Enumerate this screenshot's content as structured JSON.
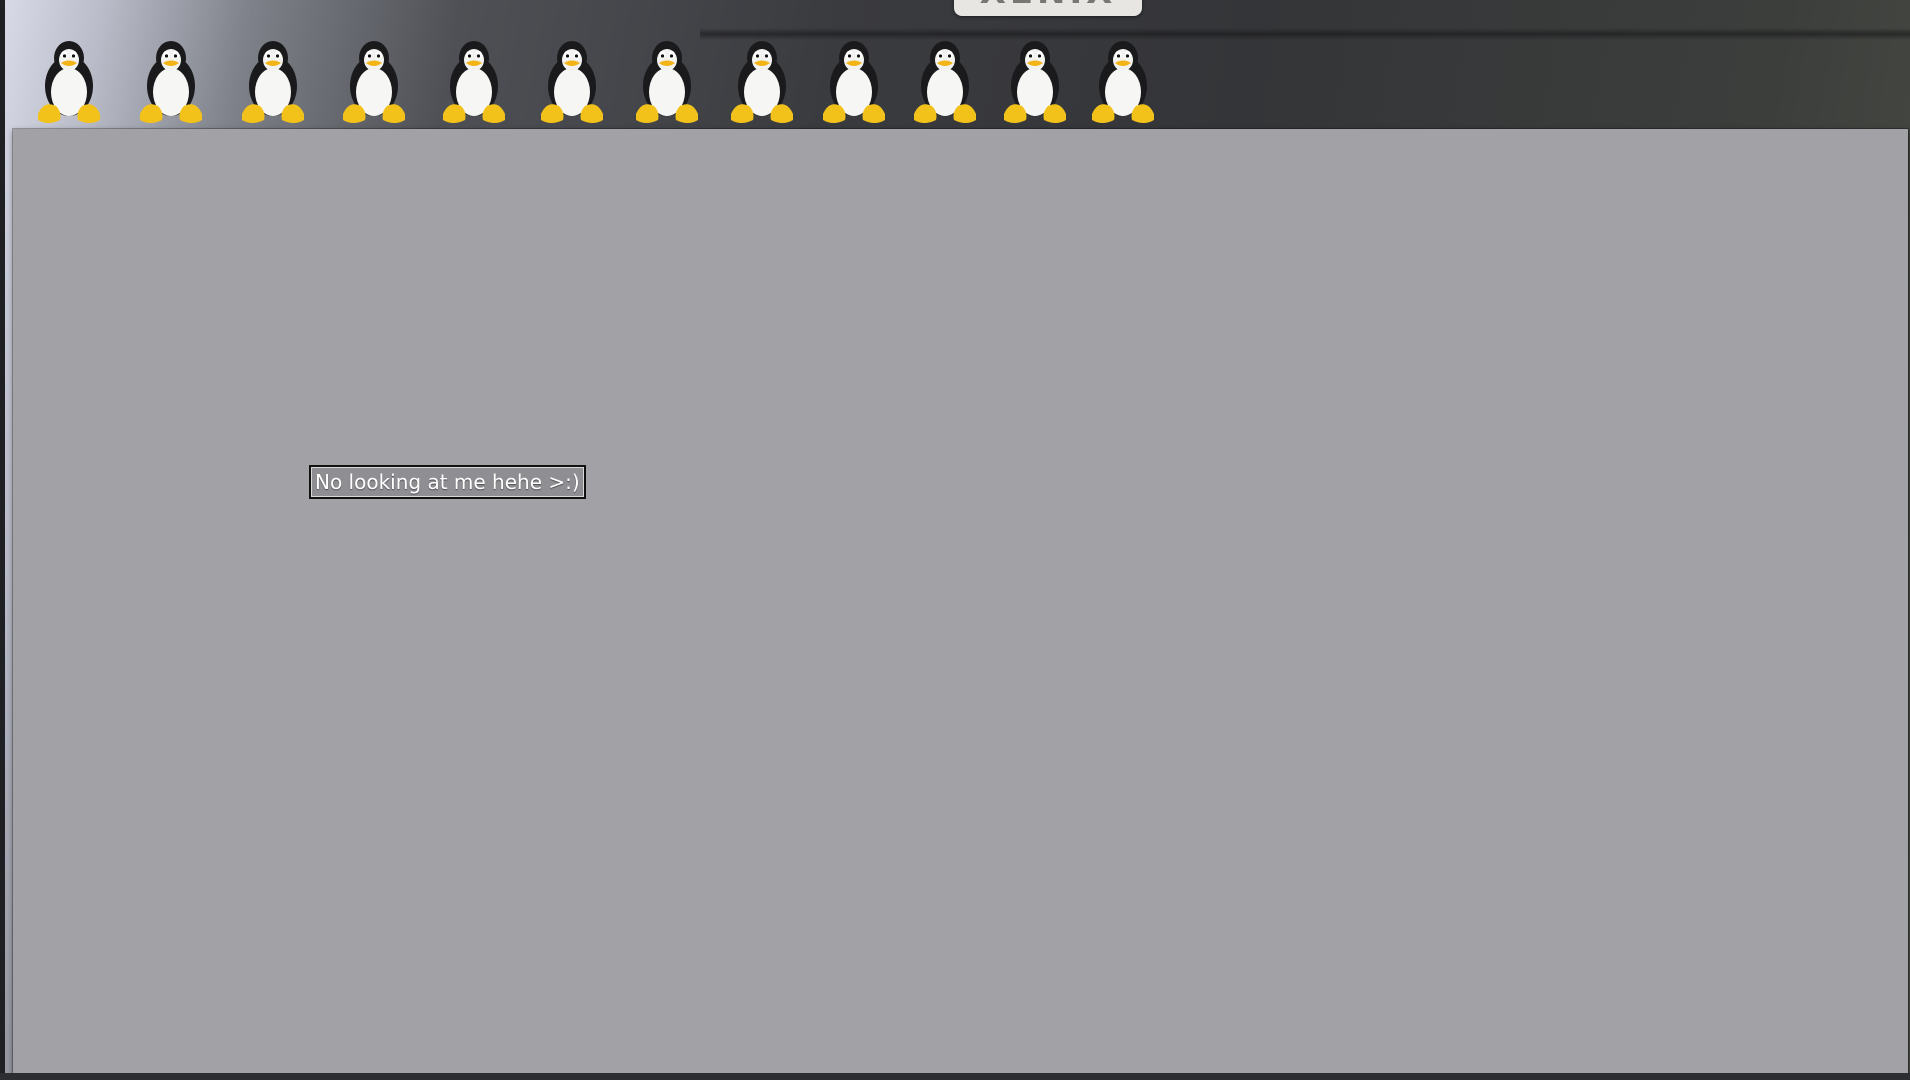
{
  "header": {
    "logo_text": "XENIX",
    "logo_mark_color": "#c8323a",
    "penguin_icon": "tux-penguin-icon",
    "penguin_count": 12
  },
  "main": {
    "panel_color": "#a2a1a6",
    "hint_text": "No looking at me hehe >:)"
  }
}
